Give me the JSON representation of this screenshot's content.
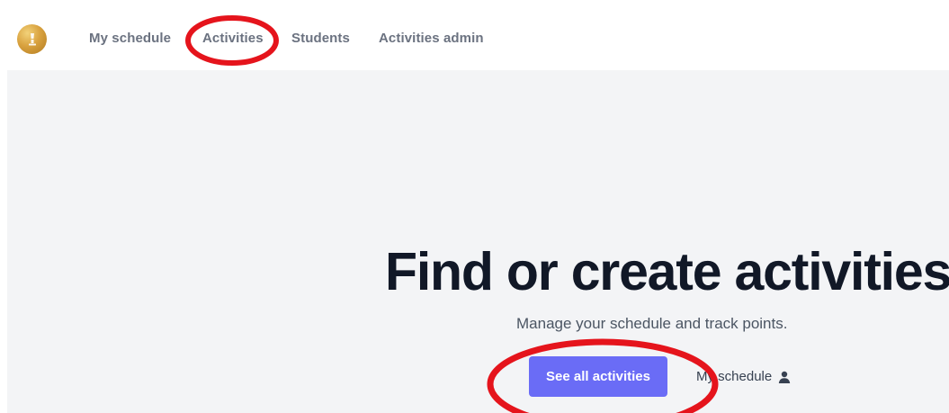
{
  "navbar": {
    "logo_icon": "trophy-icon",
    "items": [
      {
        "label": "My schedule"
      },
      {
        "label": "Activities",
        "highlighted": true
      },
      {
        "label": "Students"
      },
      {
        "label": "Activities admin"
      }
    ]
  },
  "hero": {
    "title": "Find or create activities",
    "subtitle": "Manage your schedule and track points.",
    "primary_button": "See all activities",
    "secondary_link": "My schedule",
    "secondary_icon": "user-icon"
  },
  "colors": {
    "primary": "#6a6cf6",
    "annotation": "#e5141c",
    "background": "#f3f4f6",
    "logo_gold": "#d9a23f"
  }
}
